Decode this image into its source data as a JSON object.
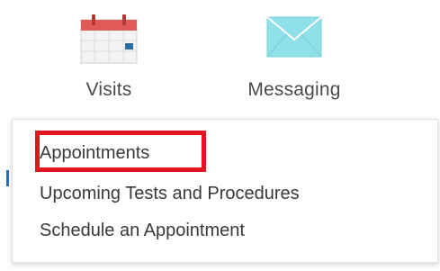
{
  "nav": {
    "visits": {
      "label": "Visits",
      "icon": "calendar-icon"
    },
    "messaging": {
      "label": "Messaging",
      "icon": "envelope-icon"
    }
  },
  "dropdown": {
    "items": [
      {
        "label": "Appointments",
        "highlighted": true
      },
      {
        "label": "Upcoming Tests and Procedures",
        "highlighted": false
      },
      {
        "label": "Schedule an Appointment",
        "highlighted": false
      }
    ],
    "highlight_color": "#e0141e",
    "accent_color": "#2e6da4"
  },
  "colors": {
    "calendar_header": "#e05a5a",
    "envelope": "#8fe0e8"
  }
}
